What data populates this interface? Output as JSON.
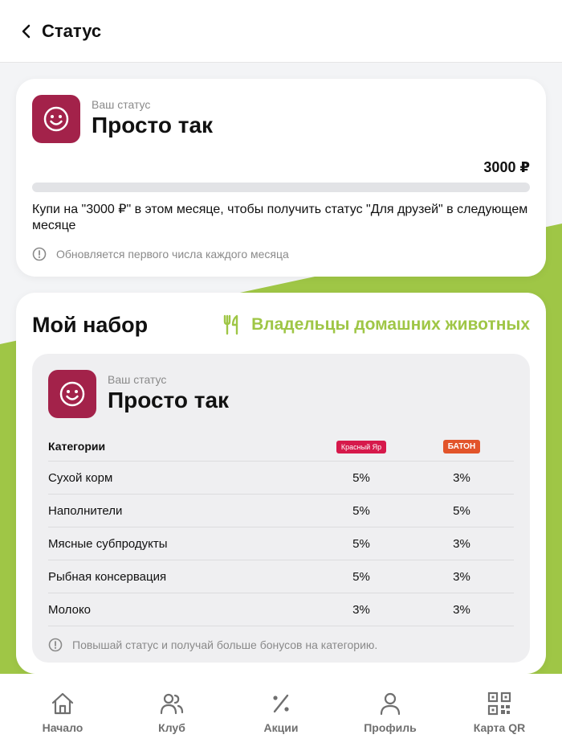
{
  "header": {
    "title": "Статус"
  },
  "status_card": {
    "caption": "Ваш статус",
    "name": "Просто так",
    "amount": "3000 ₽",
    "progress": 0.0,
    "info": "Купи на \"3000 ₽\" в этом месяце, чтобы получить статус \"Для друзей\" в следующем месяце",
    "note": "Обновляется первого числа каждого месяца"
  },
  "set_card": {
    "title": "Мой набор",
    "category": "Владельцы домашних животных",
    "caption": "Ваш статус",
    "name": "Просто так",
    "table": {
      "header": "Категории",
      "brands": [
        "Красный Яр",
        "БАТОН"
      ],
      "rows": [
        {
          "name": "Сухой корм",
          "a": "5%",
          "b": "3%"
        },
        {
          "name": "Наполнители",
          "a": "5%",
          "b": "5%"
        },
        {
          "name": "Мясные субпродукты",
          "a": "5%",
          "b": "3%"
        },
        {
          "name": "Рыбная консервация",
          "a": "5%",
          "b": "3%"
        },
        {
          "name": "Молоко",
          "a": "3%",
          "b": "3%"
        }
      ]
    },
    "note": "Повышай статус и получай больше бонусов на категорию."
  },
  "nav": [
    {
      "label": "Начало",
      "icon": "home-icon"
    },
    {
      "label": "Клуб",
      "icon": "users-icon"
    },
    {
      "label": "Акции",
      "icon": "percent-icon"
    },
    {
      "label": "Профиль",
      "icon": "profile-icon"
    },
    {
      "label": "Карта QR",
      "icon": "qr-icon"
    }
  ],
  "colors": {
    "accent": "#9fc646",
    "avatar": "#a3224a",
    "brand_a": "#d6194b",
    "brand_b": "#e2542a"
  }
}
